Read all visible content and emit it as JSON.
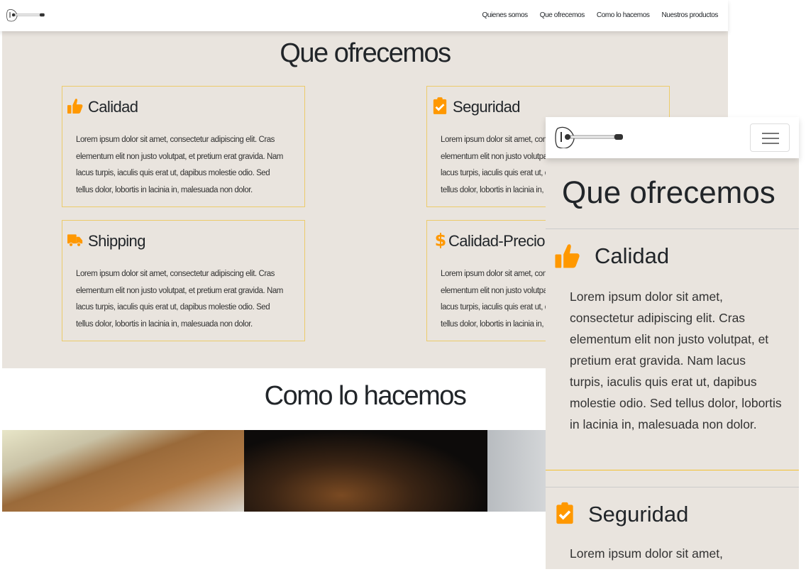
{
  "nav": {
    "links": [
      "Quienes somos",
      "Que ofrecemos",
      "Como lo hacemos",
      "Nuestros productos"
    ]
  },
  "offer": {
    "title": "Que ofrecemos",
    "cards": [
      {
        "title": "Calidad",
        "icon": "thumbs-up-icon",
        "text": "Lorem ipsum dolor sit amet, consectetur adipiscing elit. Cras elementum elit non justo volutpat, et pretium erat gravida. Nam lacus turpis, iaculis quis erat ut, dapibus molestie odio. Sed tellus dolor, lobortis in lacinia in, malesuada non dolor."
      },
      {
        "title": "Seguridad",
        "icon": "clipboard-check-icon",
        "text": "Lorem ipsum dolor sit amet, consectetur adipiscing elit. Cras elementum elit non justo volutpat, et pretium erat gravida. Nam lacus turpis, iaculis quis erat ut, dapibus molestie odio. Sed tellus dolor, lobortis in lacinia in, malesuada non dolor."
      },
      {
        "title": "Shipping",
        "icon": "truck-icon",
        "text": "Lorem ipsum dolor sit amet, consectetur adipiscing elit. Cras elementum elit non justo volutpat, et pretium erat gravida. Nam lacus turpis, iaculis quis erat ut, dapibus molestie odio. Sed tellus dolor, lobortis in lacinia in, malesuada non dolor."
      },
      {
        "title": "Calidad-Precio",
        "icon": "dollar-icon",
        "text": "Lorem ipsum dolor sit amet, consectetur adipiscing elit. Cras elementum elit non justo volutpat, et pretium erat gravida. Nam lacus turpis, iaculis quis erat ut, dapibus molestie odio. Sed tellus dolor, lobortis in lacinia in, malesuada non dolor."
      }
    ]
  },
  "how": {
    "title": "Como lo hacemos"
  },
  "mobile": {
    "title": "Que ofrecemos",
    "cards": [
      {
        "title": "Calidad",
        "text": "Lorem ipsum dolor sit amet, consectetur adipiscing elit. Cras elementum elit non justo volutpat, et pretium erat gravida. Nam lacus turpis, iaculis quis erat ut, dapibus molestie odio. Sed tellus dolor, lobortis in lacinia in, malesuada non dolor."
      },
      {
        "title": "Seguridad",
        "text": "Lorem ipsum dolor sit amet,"
      }
    ]
  },
  "colors": {
    "accent": "#ff9800",
    "border": "#eccb6a",
    "section_bg": "#e9e4de"
  }
}
